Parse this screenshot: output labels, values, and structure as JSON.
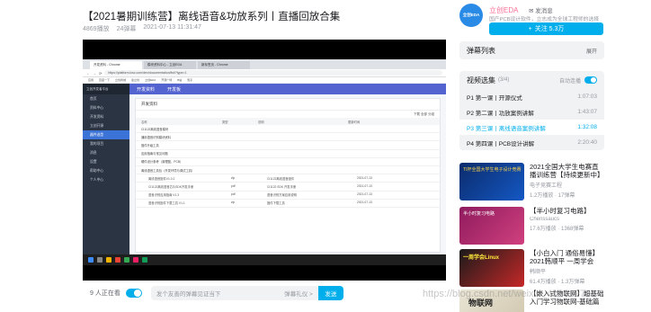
{
  "video": {
    "title": "【2021暑期训练营】离线语音&功放系列丨直播回放合集",
    "views": "4869播放",
    "danmaku_count": "24弹幕",
    "date": "2021-07-13 11:31:47"
  },
  "browser": {
    "tabs": [
      "开发资料 - Chrome",
      "模块资料中心 - 立创EDA",
      "新标签页 - Chrome"
    ],
    "url": "https://platform.lcsc.com/dev/documentation/list/?type=1",
    "bookmarks": [
      "应用",
      "百度一下",
      "立创商城",
      "嘉立创",
      "立创EDA",
      "开源广场",
      "B站",
      "知乎"
    ]
  },
  "app": {
    "logo": "立创开发者平台",
    "nav": [
      "首页",
      "资料中心",
      "开发资料",
      "立创开源",
      "器件选型",
      "我的项目",
      "消息",
      "设置",
      "帮助中心",
      "个人中心"
    ],
    "top_items": [
      "开发资料",
      "开发板"
    ],
    "panel_title": "开发资料",
    "tools": "下载  全部  分组",
    "table_headers": [
      "名称",
      "类型",
      "说明",
      "更新时间"
    ],
    "rows": [
      "CI1122离线语音模块",
      "通用语音识别模块资料",
      "固件升级工具",
      "应用指南与常见问题",
      "硬件设计参考（原理图、PCB）",
      "离线语音工具包（开发环境与调试工具）"
    ],
    "sub_rows": [
      [
        "离线语音固件V1.0.2",
        "zip",
        "CI1122离线语音固件",
        "2021-07-13"
      ],
      [
        "CI1122离线语音芯片SDK开发手册",
        "pdf",
        "CI1122 SDK 开发手册",
        "2021-07-13"
      ],
      [
        "语音识别应用指南 V1.3",
        "pdf",
        "语音识别方案应用说明",
        "2021-07-13"
      ],
      [
        "语音识别固件下载工具 V1.1",
        "zip",
        "固件下载工具",
        "2021-07-13"
      ]
    ]
  },
  "bar": {
    "viewers": "9 人正在看",
    "danmaku_placeholder": "发个友善的弹幕见证当下",
    "etiquette": "弹幕礼仪 >",
    "send": "发送"
  },
  "uploader": {
    "avatar_text": "立创EDA",
    "name": "立创EDA",
    "message": "发消息",
    "desc": "国产PCB设计软件，立志成为全球工程师的选择",
    "follow": "关注 5.3万"
  },
  "danmaku_list": {
    "title": "弹幕列表",
    "expand": "展开"
  },
  "playlist": {
    "title": "视频选集",
    "count": "(3/4)",
    "autoplay": "自动连播",
    "items": [
      {
        "label": "P1  第一课丨开源仪式",
        "time": "1:07:03"
      },
      {
        "label": "P2  第二课丨功放案例讲解",
        "time": "1:43:07"
      },
      {
        "label": "P3  第三课丨离线语音案例讲解",
        "time": "1:32:08"
      },
      {
        "label": "P4  第四课丨PCB设计讲解",
        "time": "2:20:40"
      }
    ]
  },
  "recommendations": [
    {
      "thumb_text": "TI杯全国大学生电子设计竞赛",
      "title": "2021全国大学生电赛直播训练营【持续更新中】",
      "author": "电子竞赛工程",
      "stats": "1.2万播放 · 17弹幕"
    },
    {
      "thumb_text": "半小时复习电路",
      "title": "【半小时复习电路】",
      "author": "Chenssaucs",
      "stats": "17.6万播放 · 1368弹幕"
    },
    {
      "thumb_text": "一周学会Linux",
      "title": "【小白入门 通俗易懂】2021韩顺平 一周学会Linux",
      "author": "韩顺平",
      "stats": "61.4万播放 · 1.3万弹幕"
    },
    {
      "thumb_text": "物联网",
      "title": "【嵌入式物联网】超基础入门学习物联网-基础篇",
      "author": "",
      "stats": ""
    }
  ],
  "watermark": "https://blog.csdn.net/weixin_41881970",
  "colors": {
    "accent": "#00aeec",
    "pink": "#fb7299"
  }
}
